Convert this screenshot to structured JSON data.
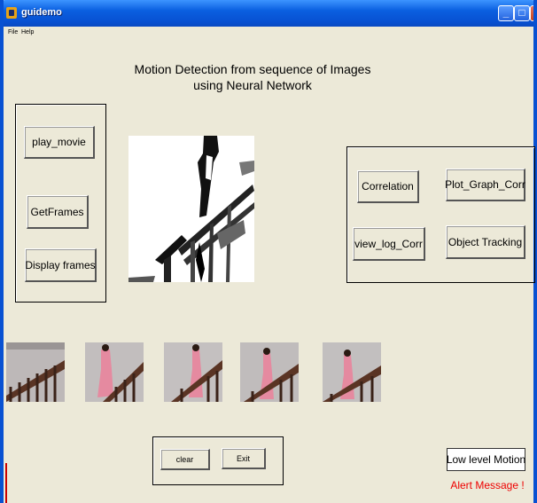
{
  "window": {
    "title": "guidemo"
  },
  "menu": [
    "File",
    "Help"
  ],
  "heading": {
    "line1": "Motion Detection from sequence of Images",
    "line2": "using Neural Network"
  },
  "left_buttons": [
    "play_movie",
    "GetFrames",
    "Display frames"
  ],
  "right_buttons": {
    "correlation": "Correlation",
    "plot_graph": "Plot_Graph_Corr",
    "view_log": "view_log_Corr",
    "tracking": "Object  Tracking"
  },
  "bottom_buttons": {
    "clear": "clear",
    "exit": "Exit"
  },
  "status": {
    "motion_level": "Low level Motion",
    "alert": "Alert Message !"
  },
  "colors": {
    "titlebar": "#0851d2",
    "background": "#ece9d8",
    "alert": "#e00000"
  },
  "frames_shown": 5
}
